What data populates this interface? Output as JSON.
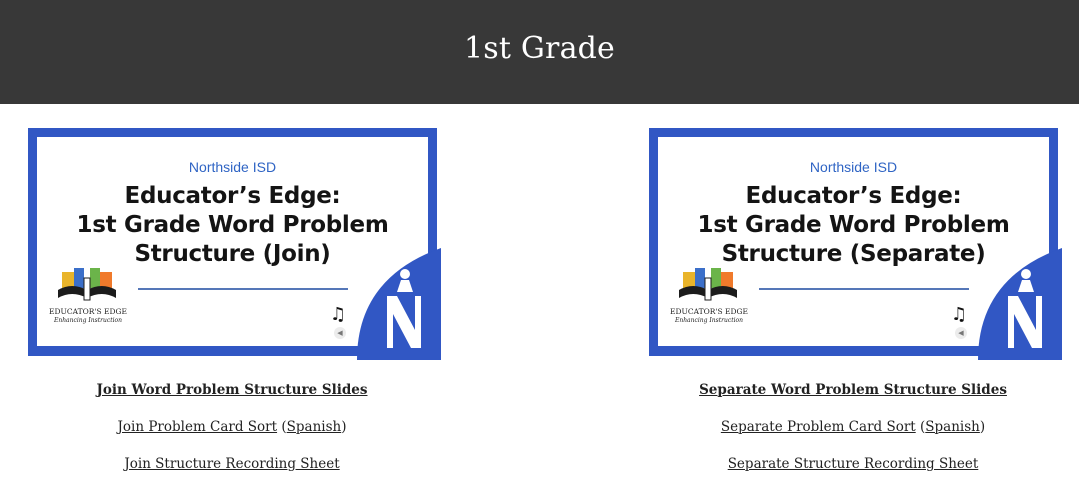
{
  "page": {
    "title": "1st Grade"
  },
  "cards": [
    {
      "org": "Northside ISD",
      "title_lines": [
        "Educator’s Edge:",
        "1st Grade Word Problem",
        "Structure (Join)"
      ],
      "logo_text": "EDUCATOR'S EDGE",
      "logo_tagline": "Enhancing Instruction",
      "links": {
        "slides": "Join Word Problem Structure Slides",
        "card_sort": "Join Problem Card Sort",
        "spanish": "Spanish",
        "recording": "Join Structure Recording Sheet"
      }
    },
    {
      "org": "Northside ISD",
      "title_lines": [
        "Educator’s Edge:",
        "1st Grade Word Problem",
        "Structure (Separate)"
      ],
      "logo_text": "EDUCATOR'S EDGE",
      "logo_tagline": "Enhancing Instruction",
      "links": {
        "slides": "Separate Word Problem Structure Slides",
        "card_sort": "Separate Problem Card Sort",
        "spanish": "Spanish",
        "recording": "Separate Structure Recording Sheet"
      }
    }
  ],
  "colors": {
    "header_bg": "#383838",
    "brand_blue": "#3157c4"
  },
  "icons": {
    "music": "music-note-icon",
    "speaker": "speaker-icon",
    "district": "northside-n-logo-icon"
  }
}
